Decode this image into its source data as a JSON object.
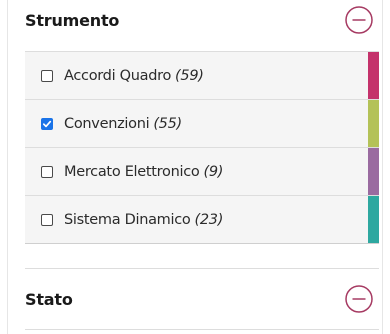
{
  "strumento": {
    "title": "Strumento",
    "options": [
      {
        "label": "Accordi Quadro",
        "count": "(59)",
        "checked": false,
        "color": "#c4326b"
      },
      {
        "label": "Convenzioni",
        "count": "(55)",
        "checked": true,
        "color": "#b4c258"
      },
      {
        "label": "Mercato Elettronico",
        "count": "(9)",
        "checked": false,
        "color": "#9a6ba0"
      },
      {
        "label": "Sistema Dinamico",
        "count": "(23)",
        "checked": false,
        "color": "#2ea8a0"
      }
    ]
  },
  "stato": {
    "title": "Stato"
  },
  "icons": {
    "collapse": "minus-circle-icon",
    "check": "check-icon"
  },
  "colors": {
    "accent": "#a63a62",
    "checkbox_checked": "#1a73e8"
  }
}
